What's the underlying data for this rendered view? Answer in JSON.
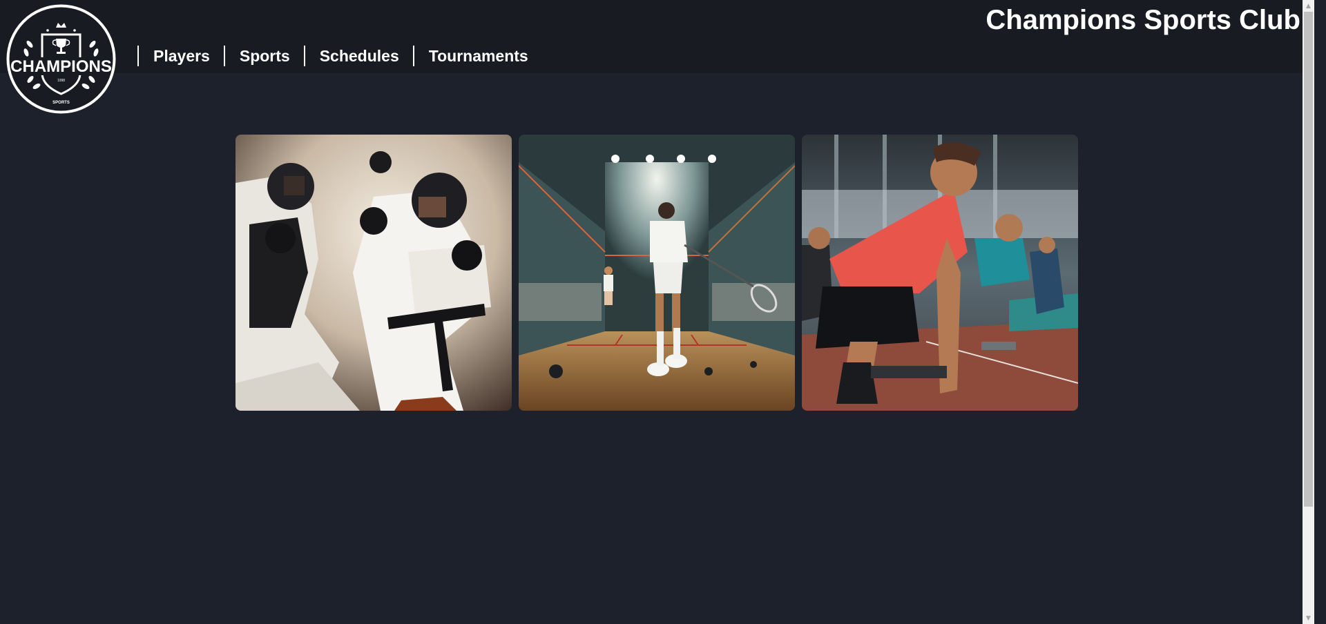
{
  "header": {
    "site_title": "Champions Sports Club",
    "logo": {
      "icon": "champions-crest-icon",
      "text": "CHAMPIONS",
      "year": "1998",
      "subtext": "SPORTS"
    }
  },
  "nav": {
    "items": [
      {
        "label": "Players"
      },
      {
        "label": "Sports"
      },
      {
        "label": "Schedules"
      },
      {
        "label": "Tournaments"
      }
    ]
  },
  "gallery": {
    "images": [
      {
        "name": "karate-sparring-image",
        "subject": "martial arts sparring"
      },
      {
        "name": "squash-court-image",
        "subject": "squash court"
      },
      {
        "name": "sprint-start-image",
        "subject": "sprinters at starting blocks"
      }
    ]
  },
  "colors": {
    "page_background": "#1c212b",
    "header_background": "#181c22",
    "text": "#ffffff"
  }
}
